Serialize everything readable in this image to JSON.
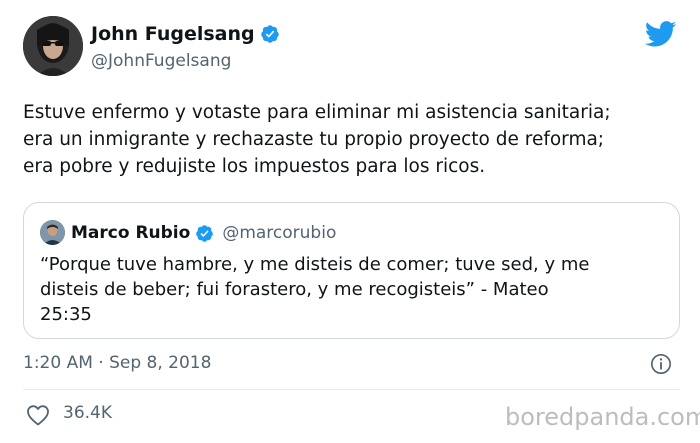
{
  "tweet": {
    "author": {
      "name": "John Fugelsang",
      "handle": "@JohnFugelsang",
      "verified": true
    },
    "text_lines": [
      "Estuve enfermo y votaste para eliminar mi asistencia sanitaria;",
      "era un inmigrante y rechazaste tu propio proyecto de reforma;",
      "era pobre y redujiste los impuestos para los ricos."
    ],
    "quoted": {
      "author_name": "Marco Rubio",
      "handle": "@marcorubio",
      "verified": true,
      "text_lines": [
        "“Porque tuve hambre, y me disteis de comer; tuve sed, y me",
        "disteis de beber; fui forastero, y me recogisteis” - Mateo",
        "25:35"
      ]
    },
    "timestamp": "1:20 AM · Sep 8, 2018",
    "likes": "36.4K"
  },
  "icons": {
    "brand": "twitter-bird-icon",
    "verified": "verified-badge-icon",
    "info": "info-icon",
    "like": "heart-icon"
  },
  "colors": {
    "twitter_blue": "#1d9bf0",
    "text": "#0f1419",
    "secondary_text": "#536471",
    "border": "#cfd9de"
  },
  "watermark": "boredpanda.com"
}
